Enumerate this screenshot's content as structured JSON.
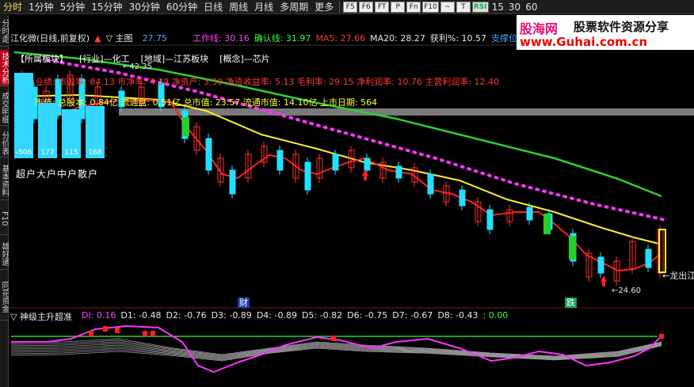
{
  "toolbar": {
    "periods": [
      "分时",
      "1分钟",
      "5分钟",
      "15分钟",
      "30分钟",
      "60分钟",
      "日线",
      "周线",
      "月线",
      "多周期",
      "更多"
    ],
    "active": "分时",
    "icons": [
      "F5",
      "F6",
      "FT",
      "P",
      "Fn",
      "F10",
      "~",
      "T",
      "RSI"
    ],
    "nums": [
      "15",
      "30",
      "60"
    ]
  },
  "left_tabs": [
    "分时走势",
    "技术分析",
    "成交明细",
    "分价表",
    "基本资料",
    "F10",
    "雄好通",
    "同花资金"
  ],
  "active_left_tab": "技术分析",
  "watermark": {
    "brand": "股海网",
    "slogan": "股票软件资源分享",
    "url": "www.Guhai.com.cn"
  },
  "chart_header": {
    "stock": "江化微(日线,前复权)",
    "main_label": "主图",
    "value_27": "27.75",
    "work_line": "工作线: 30.16",
    "confirm_line": "确认线: 31.97",
    "ma5": "MA5: 27.66",
    "ma20": "MA20: 28.27",
    "profit": "获利%: 10.57",
    "support": "支撑位"
  },
  "sector_line": [
    "【所属板块】",
    "[行业]—化工",
    "[地域]—江苏板块",
    "[概念]—芯片"
  ],
  "perf_line": "当前业绩: 市盈率: 84.13 市净率: 4.39 净资产: 3.30 净资收益率: 5.13 毛利率: 29.15 净利润率: 10.76 主营利润率: 12.40",
  "value_line": "市值: 总股本: 0.84亿 流通盘: 0.51亿 总市值: 23.57 流通市值: 14.10亿 上市日期: 564",
  "funds": {
    "values": [
      "-506",
      "177",
      "115",
      "168"
    ],
    "labels": "超户大户中户散户"
  },
  "chart_labels": {
    "high": "42.35",
    "low": "24.60",
    "right_mark": "龙出江",
    "event_cai": "财",
    "event_die": "跌"
  },
  "indicator": {
    "name": "神级主升超准",
    "di": "DI: 0.16",
    "d1": "D1: -0.48",
    "d2": "D2: -0.76",
    "d3": "D3: -0.89",
    "d4": "D4: -0.89",
    "d5": "D5: -0.82",
    "d6": "D6: -0.75",
    "d7": "D7: -0.67",
    "d8": "D8: -0.43",
    "tail": ": 0.00"
  },
  "chart_data": {
    "type": "candlestick",
    "series": [
      {
        "name": "工作线",
        "color": "#ffffff"
      },
      {
        "name": "确认线",
        "color": "#3aff3a"
      },
      {
        "name": "MA5",
        "color": "#ff2a2a"
      },
      {
        "name": "MA20",
        "color": "#ffff3a"
      }
    ],
    "price_high": 42.35,
    "price_low": 24.6
  }
}
